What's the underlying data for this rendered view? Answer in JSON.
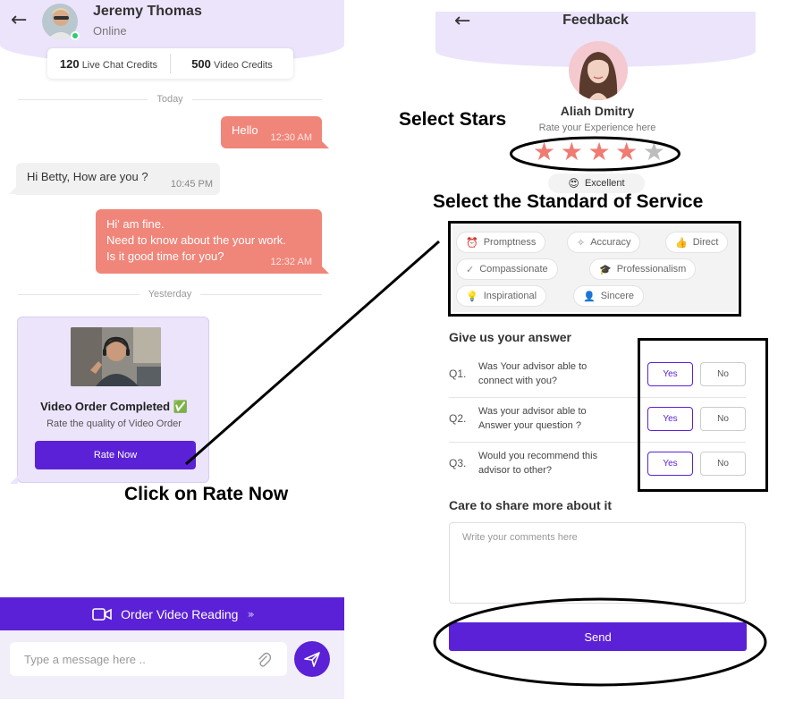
{
  "chat": {
    "contact_name": "Jeremy Thomas",
    "contact_status": "Online",
    "credits": [
      {
        "count": "120",
        "label": "Live Chat Credits"
      },
      {
        "count": "500",
        "label": "Video Credits"
      }
    ],
    "day_today": "Today",
    "day_yesterday": "Yesterday",
    "messages": [
      {
        "dir": "out",
        "text": "Hello",
        "time": "12:30 AM"
      },
      {
        "dir": "in",
        "text": "Hi Betty, How are you ?",
        "time": "10:45 PM"
      },
      {
        "dir": "out",
        "lines": [
          "Hi' am fine.",
          "Need to know about the your work.",
          "Is it good time for you?"
        ],
        "time": "12:32 AM"
      }
    ],
    "video_card": {
      "title": "Video Order Completed",
      "check_icon": "✅",
      "subtitle": "Rate the quality of Video Order",
      "button": "Rate Now"
    },
    "order_video_label": "Order Video Reading",
    "input_placeholder": "Type a message here .."
  },
  "feedback": {
    "title": "Feedback",
    "advisor_name": "Aliah Dmitry",
    "rate_prompt": "Rate your Experience here",
    "rating": 4,
    "rating_max": 5,
    "rating_label": "Excellent",
    "rating_emoji": "😍",
    "service_chips": [
      {
        "label": "Promptness",
        "icon": "alarm-clock-icon",
        "glyph": "⏰"
      },
      {
        "label": "Accuracy",
        "icon": "sparkle-icon",
        "glyph": "✧"
      },
      {
        "label": "Direct",
        "icon": "thumbs-up-icon",
        "glyph": "👍"
      },
      {
        "label": "Compassionate",
        "icon": "check-circle-icon",
        "glyph": "✓"
      },
      {
        "label": "Professionalism",
        "icon": "graduation-cap-icon",
        "glyph": "🎓"
      },
      {
        "label": "Inspirational",
        "icon": "lightbulb-icon",
        "glyph": "💡"
      },
      {
        "label": "Sincere",
        "icon": "person-icon",
        "glyph": "👤"
      }
    ],
    "answer_title": "Give us your answer",
    "questions": [
      {
        "num": "Q1.",
        "lines": [
          "Was Your advisor able to",
          "connect with you?"
        ],
        "yes": "Yes",
        "no": "No"
      },
      {
        "num": "Q2.",
        "lines": [
          "Was your advisor able to",
          "Answer your question ?"
        ],
        "yes": "Yes",
        "no": "No"
      },
      {
        "num": "Q3.",
        "lines": [
          "Would you recommend this",
          "advisor to other?"
        ],
        "yes": "Yes",
        "no": "No"
      }
    ],
    "care_title": "Care to share more about it",
    "comments_placeholder": "Write your comments here",
    "send_label": "Send"
  },
  "annotations": {
    "select_stars": "Select Stars",
    "select_service": "Select the Standard of Service",
    "click_rate": "Click on Rate Now"
  },
  "colors": {
    "primary": "#5b21d6",
    "header_bg": "#ece4fb",
    "outgoing_bubble": "#f0857a",
    "star_filled": "#ef7b73",
    "star_empty": "#bdbdbd"
  }
}
